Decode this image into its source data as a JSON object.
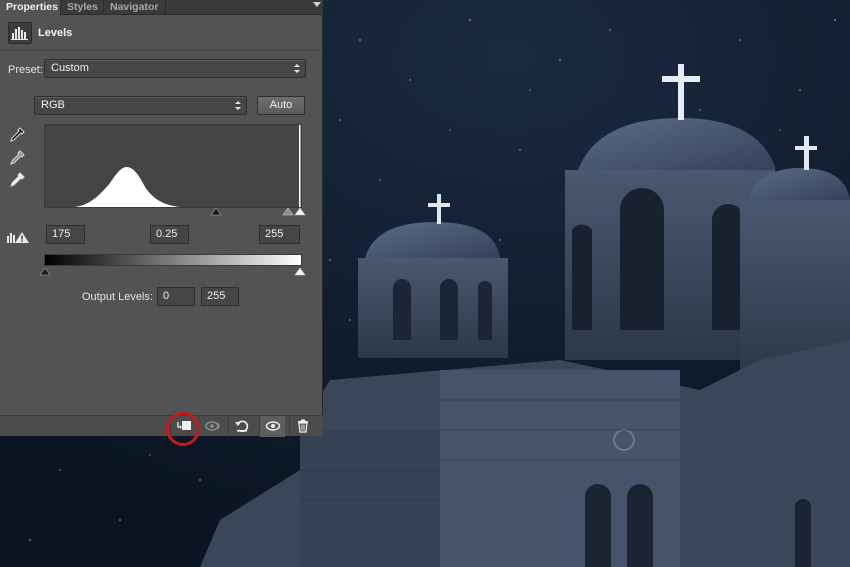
{
  "tabs": [
    {
      "label": "Properties"
    },
    {
      "label": "Styles"
    },
    {
      "label": "Navigator"
    }
  ],
  "adjustment": {
    "icon": "levels-histogram-icon",
    "title": "Levels"
  },
  "preset": {
    "label": "Preset:",
    "value": "Custom"
  },
  "channel": {
    "value": "RGB",
    "auto_label": "Auto"
  },
  "input_levels": {
    "black": "175",
    "gamma": "0.25",
    "white": "255"
  },
  "output_levels": {
    "label": "Output Levels:",
    "black": "0",
    "white": "255"
  },
  "footer_buttons": [
    {
      "icon": "clip-to-layer-icon",
      "highlighted": true
    },
    {
      "icon": "view-previous-state-icon"
    },
    {
      "icon": "reset-icon"
    },
    {
      "icon": "visibility-eye-icon"
    },
    {
      "icon": "trash-icon"
    }
  ],
  "colors": {
    "panel_bg": "#535353",
    "highlight_ring": "#c81a1a",
    "sky": "#0f1a2a"
  }
}
